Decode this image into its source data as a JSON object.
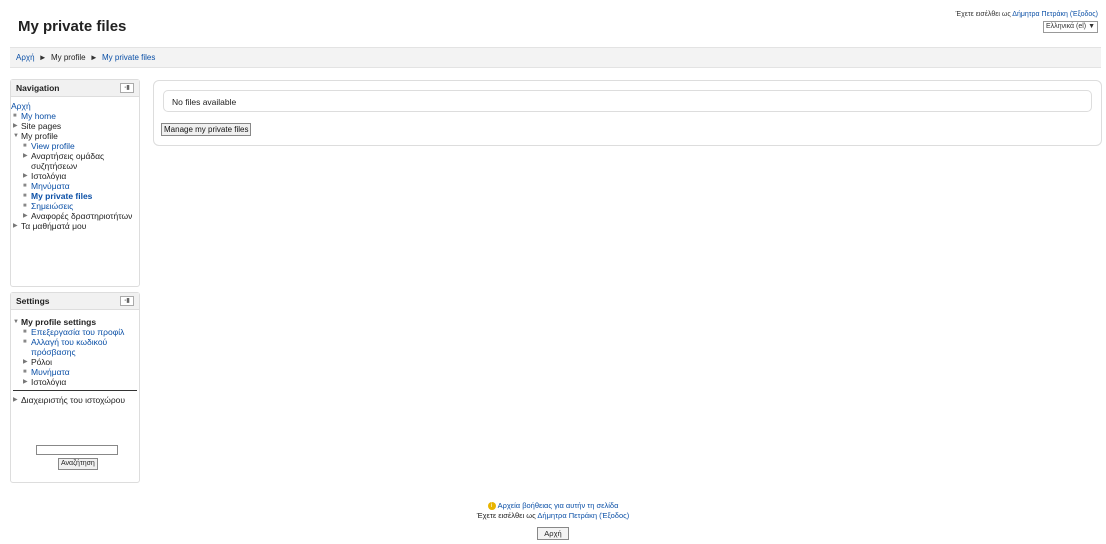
{
  "page": {
    "title": "My private files"
  },
  "header": {
    "login_prefix": "Έχετε εισέλθει ως",
    "user_name": "Δήμητρα Πετράκη",
    "logout": "(Έξοδος)",
    "language": "Ελληνικά (el) ▼"
  },
  "breadcrumb": {
    "items": [
      "Αρχή",
      "My profile",
      "My private files"
    ],
    "separator": "►"
  },
  "navigation": {
    "title": "Navigation",
    "toggle": "-▮",
    "home": "Αρχή",
    "my_home": "My home",
    "site_pages": "Site pages",
    "my_profile": "My profile",
    "view_profile": "View profile",
    "forum_posts": "Αναρτήσεις ομάδας συζητήσεων",
    "blogs": "Ιστολόγια",
    "messages": "Μηνύματα",
    "private_files": "My private files",
    "notes": "Σημειώσεις",
    "activity_reports": "Αναφορές δραστηριοτήτων",
    "my_courses": "Τα μαθήματά μου"
  },
  "settings": {
    "title": "Settings",
    "toggle": "-▮",
    "profile_settings": "My profile settings",
    "edit_profile": "Επεξεργασία του προφίλ",
    "change_password": "Αλλαγή του κωδικού πρόσβασης",
    "roles": "Ρόλοι",
    "messages": "Μυνήματα",
    "blogs": "Ιστολόγια",
    "site_admin": "Διαχειριστής του ιστοχώρου",
    "search_value": "",
    "search_button": "Αναζήτηση"
  },
  "main": {
    "no_files": "No files available",
    "manage_button": "Manage my private files"
  },
  "footer": {
    "help_link": "Αρχεία βοήθειας για αυτήν τη σελίδα",
    "login_text": "Έχετε εισέλθει ως",
    "user_name": "Δήμητρα Πετράκη",
    "logout": "(Έξοδος)",
    "home_button": "Αρχή"
  },
  "colors": {
    "link": "#0a4fa6",
    "block_header": "#f1f1f1",
    "help_icon": "#e8b400"
  }
}
